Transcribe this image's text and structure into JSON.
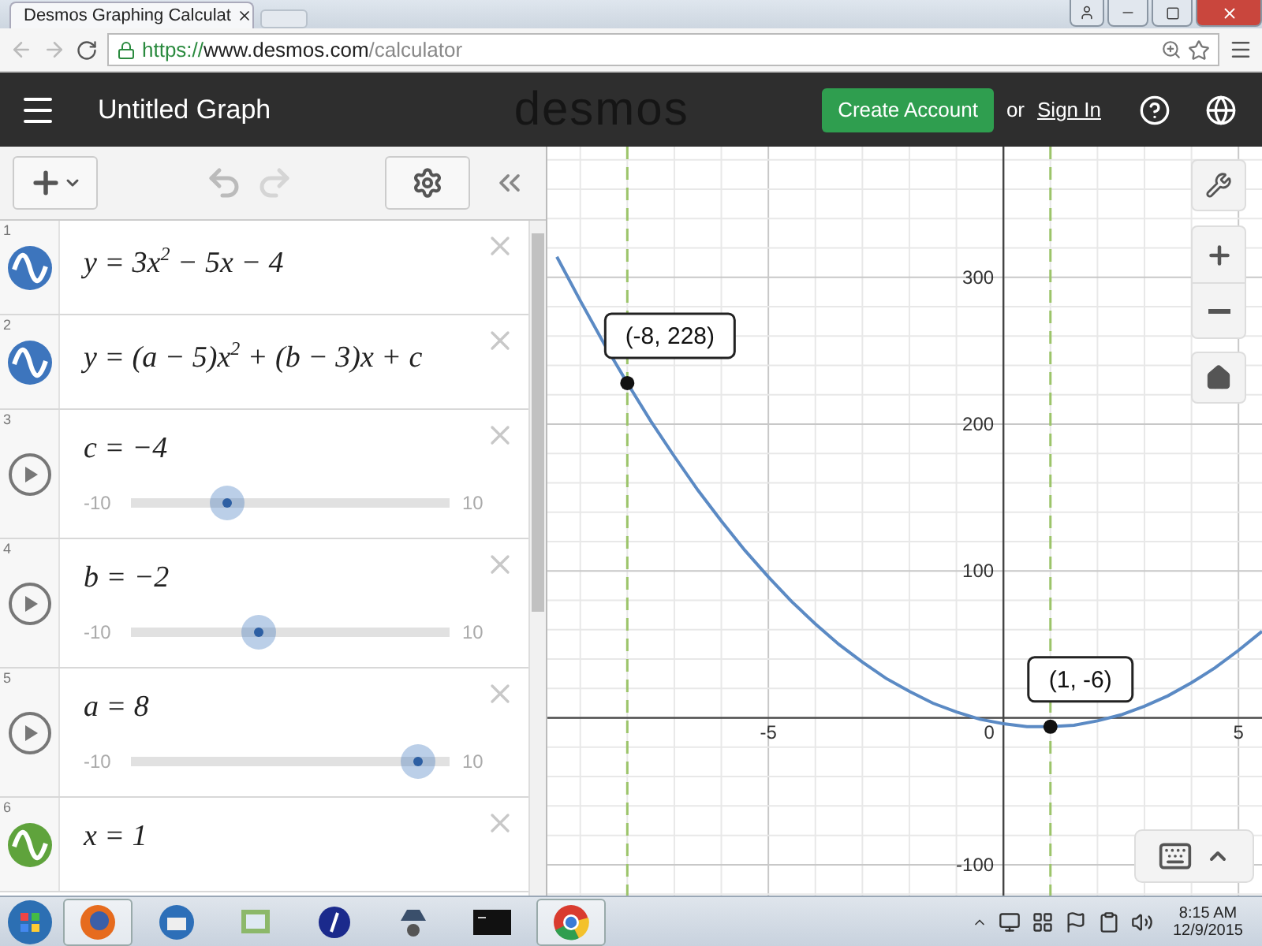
{
  "browser": {
    "tab_title": "Desmos Graphing Calculat",
    "secure": true,
    "url": [
      {
        "kind": "scheme",
        "text": "https://"
      },
      {
        "kind": "host",
        "text": "www.desmos.com"
      },
      {
        "kind": "path",
        "text": "/calculator"
      }
    ]
  },
  "header": {
    "title": "Untitled Graph",
    "logo": "desmos",
    "create_account": "Create Account",
    "or": "or",
    "sign_in": "Sign In"
  },
  "expressions": [
    {
      "kind": "graph",
      "index": "1",
      "color": "#3d75bd",
      "math": "y = 3x$^{2}$ − 5x − 4"
    },
    {
      "kind": "graph",
      "index": "2",
      "color": "#3d75bd",
      "math": "y = (a − 5)x$^{2}$ + (b − 3)x + c"
    },
    {
      "kind": "slider",
      "index": "3",
      "math": "c = −4",
      "min": "-10",
      "max": "10",
      "level": 0.3
    },
    {
      "kind": "slider",
      "index": "4",
      "math": "b = −2",
      "min": "-10",
      "max": "10",
      "level": 0.4
    },
    {
      "kind": "slider",
      "index": "5",
      "math": "a = 8",
      "min": "-10",
      "max": "10",
      "level": 0.9
    },
    {
      "kind": "graph",
      "index": "6",
      "color": "#5fa33c",
      "math": "x = 1"
    }
  ],
  "graph": {
    "origin_label": "0",
    "chart_data": {
      "type": "line",
      "x": [
        -9.5,
        -9,
        -8.5,
        -8,
        -7.5,
        -7,
        -6.5,
        -6,
        -5.5,
        -5,
        -4.5,
        -4,
        -3.5,
        -3,
        -2.5,
        -2,
        -1.5,
        -1,
        -0.5,
        0,
        0.5,
        1,
        1.5,
        2,
        2.5,
        3,
        3.5,
        4,
        4.5,
        5,
        5.5
      ],
      "series": [
        {
          "color": "#5b8ac4",
          "values": [
            314,
            284,
            255,
            228,
            202,
            178,
            155,
            134,
            114,
            96,
            79,
            64,
            50,
            38,
            27,
            18,
            10,
            4,
            -1,
            -4,
            -6,
            -6,
            -5,
            -2,
            2,
            8,
            15,
            24,
            34,
            46,
            59
          ]
        }
      ],
      "xlim": [
        -9.7,
        5.5
      ],
      "ylim": [
        -121,
        389
      ],
      "xticks": [
        -5,
        5
      ],
      "yticks": [
        -100,
        100,
        200,
        300
      ],
      "grid": true,
      "ref_lines": [
        {
          "axis": "x",
          "value": -8,
          "color": "#9cc46a"
        },
        {
          "axis": "x",
          "value": 1,
          "color": "#9cc46a"
        }
      ],
      "annotations": [
        {
          "x": -8,
          "y": 228,
          "text": "(-8, 228)"
        },
        {
          "x": 1,
          "y": -6,
          "text": "(1, -6)"
        }
      ]
    }
  },
  "taskbar": {
    "apps": [
      {
        "kind": "fox",
        "selected": true
      },
      {
        "kind": "mail",
        "selected": false
      },
      {
        "kind": "tool",
        "selected": false
      },
      {
        "kind": "disc",
        "selected": false
      },
      {
        "kind": "hat",
        "selected": false
      },
      {
        "kind": "terminal",
        "selected": false
      },
      {
        "kind": "chrome",
        "selected": true
      }
    ],
    "time": "8:15 AM",
    "date": "12/9/2015"
  }
}
